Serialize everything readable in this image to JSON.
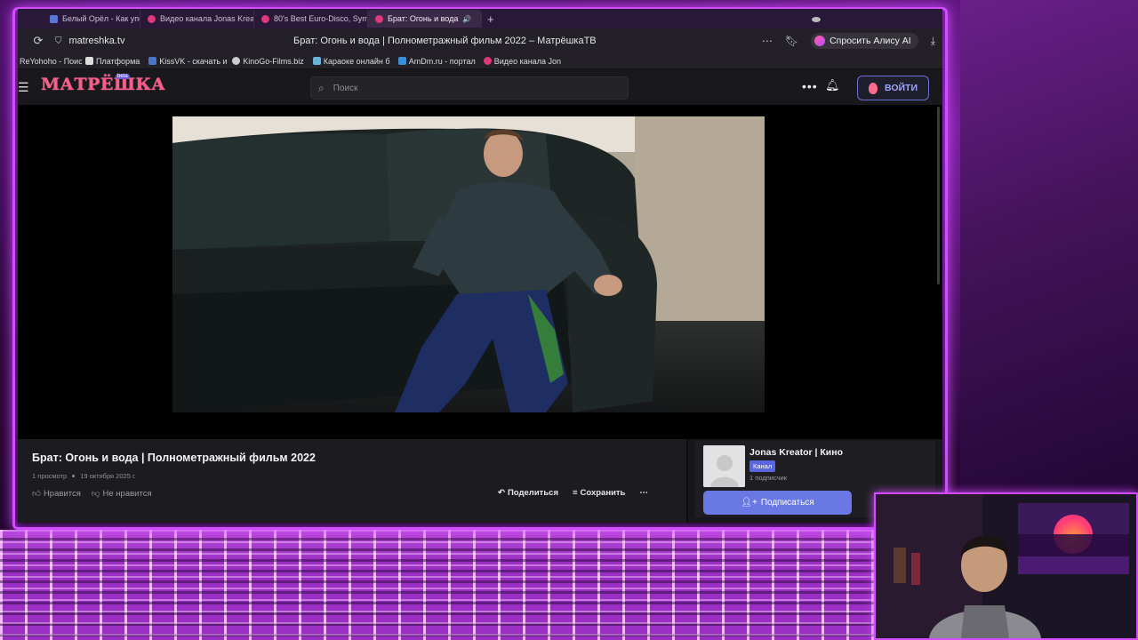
{
  "tabs": [
    {
      "label": "Белый Орёл - Как упоите",
      "active": false,
      "icon": "blue"
    },
    {
      "label": "Видео канала Jonas Kreat",
      "active": false,
      "icon": "matreshka"
    },
    {
      "label": "80's Best Euro-Disco, Sym",
      "active": false,
      "icon": "matreshka"
    },
    {
      "label": "Брат: Огонь и вода",
      "active": true,
      "icon": "matreshka"
    }
  ],
  "address": {
    "url": "matreshka.tv",
    "title": "Брат: Огонь и вода | Полнометражный фильм 2022 – МатрёшкаТВ",
    "alice_label": "Спросить Алису AI"
  },
  "bookmarks": [
    {
      "label": "ReYohoho - Поиск"
    },
    {
      "label": "Платформа"
    },
    {
      "label": "KissVK - скачать и"
    },
    {
      "label": "KinoGo-Films.biz"
    },
    {
      "label": "Караоке онлайн б"
    },
    {
      "label": "AmDm.ru - портал"
    },
    {
      "label": "Видео канала Jon"
    }
  ],
  "site": {
    "logo": "МАТРЁШКА",
    "logo_badge": "beta",
    "search_placeholder": "Поиск",
    "login_label": "ВОЙТИ"
  },
  "video": {
    "title": "Брат: Огонь и вода | Полнометражный фильм 2022",
    "views": "1 просмотр",
    "date": "19 октября 2025 г.",
    "like_label": "Нравится",
    "dislike_label": "Не нравится",
    "share_label": "Поделиться",
    "save_label": "Сохранить"
  },
  "channel": {
    "name": "Jonas Kreator | Кино",
    "badge": "Канал",
    "subscribers": "1 подписчик",
    "subscribe_label": "Подписаться"
  },
  "colors": {
    "neon": "#d24bff",
    "accent": "#6a78e6",
    "logo": "#ff5b8a"
  }
}
